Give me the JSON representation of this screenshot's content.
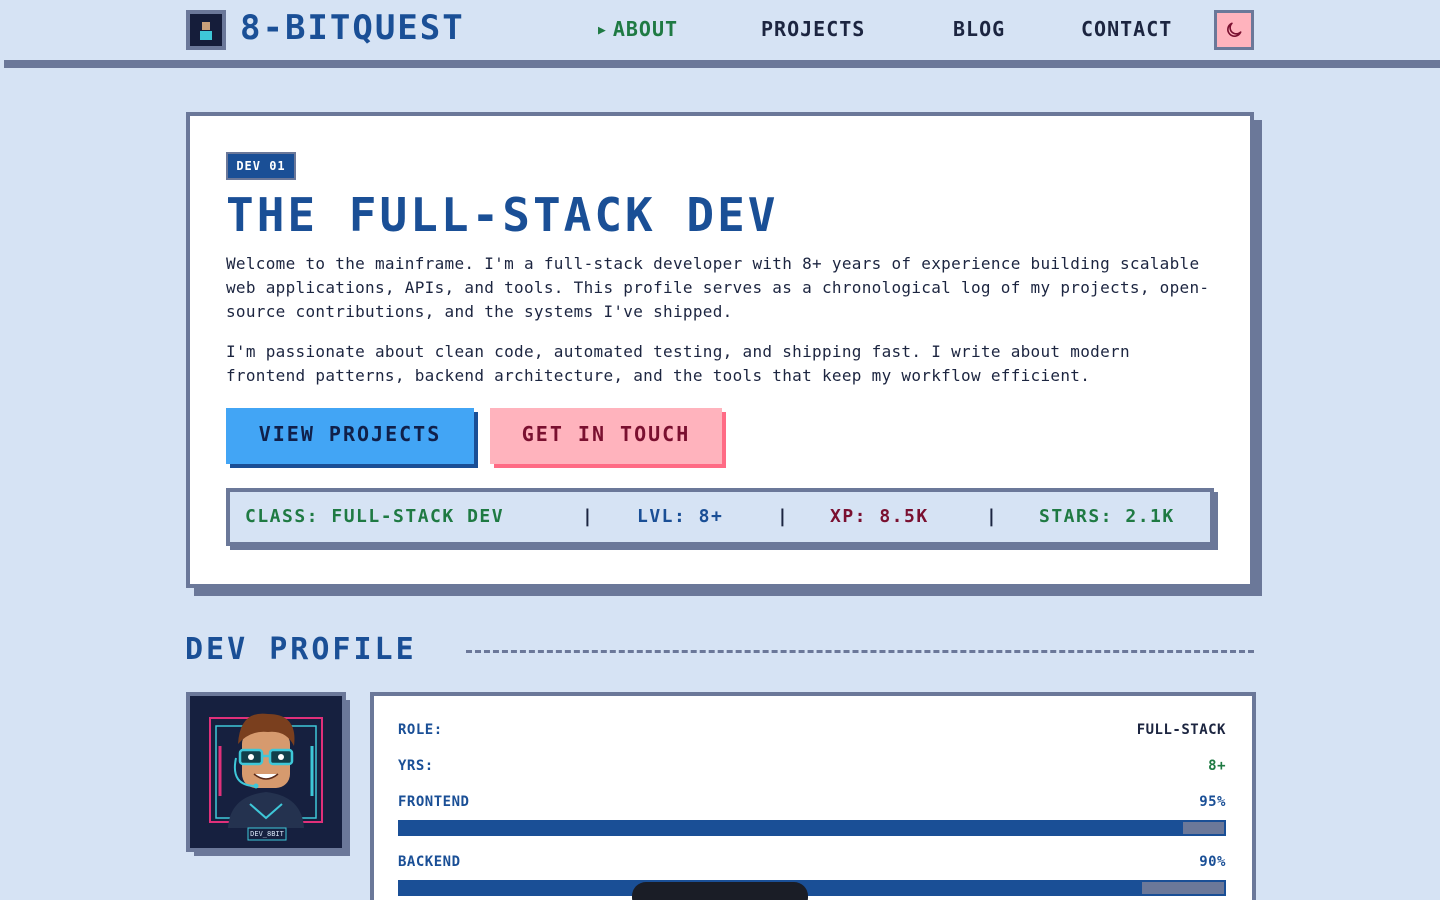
{
  "header": {
    "brand": "8-BITQUEST",
    "logo_icon": "pixel-avatar-icon",
    "nav": [
      {
        "label": "ABOUT",
        "active": true
      },
      {
        "label": "PROJECTS",
        "active": false
      },
      {
        "label": "BLOG",
        "active": false
      },
      {
        "label": "CONTACT",
        "active": false
      }
    ],
    "active_marker": "▶",
    "theme_toggle_icon": "moon-icon"
  },
  "hero": {
    "badge": "DEV 01",
    "title": "THE FULL-STACK DEV",
    "paragraphs": [
      "Welcome to the mainframe. I'm a full-stack developer with 8+ years of experience building scalable web applications, APIs, and tools. This profile serves as a chronological log of my projects, open-source contributions, and the systems I've shipped.",
      "I'm passionate about clean code, automated testing, and shipping fast. I write about modern frontend patterns, backend architecture, and the tools that keep my workflow efficient."
    ],
    "buttons": {
      "primary": "VIEW PROJECTS",
      "secondary": "GET IN TOUCH"
    },
    "stats": [
      {
        "text": "CLASS: FULL-STACK DEV",
        "color": "#1f7a43"
      },
      {
        "text": "LVL: 8+",
        "color": "#1a4f96"
      },
      {
        "text": "XP: 8.5K",
        "color": "#7a1030"
      },
      {
        "text": "STARS: 2.1K",
        "color": "#1f7a43"
      }
    ],
    "stat_separator": "|"
  },
  "profile": {
    "section_title": "DEV PROFILE",
    "avatar_tag": "DEV_8BIT",
    "rows": [
      {
        "label": "ROLE:",
        "value": "FULL-STACK",
        "value_color": "#1c2540"
      },
      {
        "label": "YRS:",
        "value": "8+",
        "value_color": "#1f7a43"
      },
      {
        "label": "FRONTEND",
        "value": "95%",
        "value_color": "#1a4f96",
        "level": 0.95
      },
      {
        "label": "BACKEND",
        "value": "90%",
        "value_color": "#1a4f96",
        "level": 0.9
      }
    ]
  },
  "colors": {
    "background": "#d6e3f4",
    "primary_blue": "#1a4f96",
    "accent_green": "#1f7a43",
    "accent_pink": "#ffb3bd",
    "button_blue": "#42a5f5",
    "shadow": "#6b7899"
  }
}
